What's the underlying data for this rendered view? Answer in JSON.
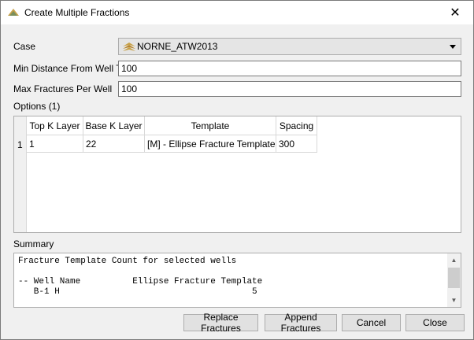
{
  "window": {
    "title": "Create Multiple Fractions",
    "close_glyph": "✕"
  },
  "form": {
    "case_label": "Case",
    "case_value": "NORNE_ATW2013",
    "min_distance_label": "Min Distance From Well TD",
    "min_distance_value": "100",
    "max_fractures_label": "Max Fractures Per Well",
    "max_fractures_value": "100"
  },
  "options": {
    "label": "Options (1)",
    "columns": [
      "Top K Layer",
      "Base K Layer",
      "Template",
      "Spacing"
    ],
    "rows": [
      {
        "index": "1",
        "top_k": "1",
        "base_k": "22",
        "template": "[M] - Ellipse Fracture Template",
        "spacing": "300"
      }
    ]
  },
  "summary": {
    "label": "Summary",
    "lines": [
      "Fracture Template Count for selected wells",
      "",
      "-- Well Name          Ellipse Fracture Template",
      "   B-1 H                                     5"
    ]
  },
  "buttons": {
    "replace": "Replace Fractures",
    "append": "Append Fractures",
    "cancel": "Cancel",
    "close": "Close"
  },
  "icons": {
    "app": "fracture-app-icon",
    "case": "eclipse-case-icon",
    "accent_colors": [
      "#c8a24a",
      "#7a8f5c"
    ]
  }
}
